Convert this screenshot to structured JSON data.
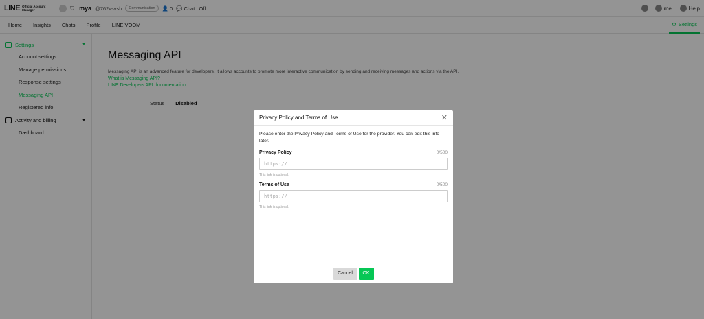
{
  "header": {
    "logo_text": "LINE",
    "logo_sub": "Official Account Manager",
    "account_name": "mya",
    "account_id": "@762vsvsb",
    "account_badge": "Communication",
    "followers": "0",
    "chat_status": "Chat : Off",
    "user_name": "mei",
    "help_label": "Help"
  },
  "nav": {
    "tabs": [
      "Home",
      "Insights",
      "Chats",
      "Profile",
      "LINE VOOM"
    ],
    "settings_label": "Settings"
  },
  "sidebar": {
    "settings_group": "Settings",
    "settings_items": [
      "Account settings",
      "Manage permissions",
      "Response settings",
      "Messaging API",
      "Registered info"
    ],
    "billing_group": "Activity and billing",
    "billing_items": [
      "Dashboard"
    ]
  },
  "main": {
    "title": "Messaging API",
    "description": "Messaging API is an advanced feature for developers. It allows accounts to promote more interactive communication by sending and receiving messages and actions via the API.",
    "link1": "What is Messaging API?",
    "link2": "LINE Developers API documentation",
    "status_label": "Status",
    "status_value": "Disabled"
  },
  "modal": {
    "title": "Privacy Policy and Terms of Use",
    "description": "Please enter the Privacy Policy and Terms of Use for the provider. You can edit this info later.",
    "privacy_label": "Privacy Policy",
    "privacy_count": "0/500",
    "privacy_placeholder": "https://",
    "privacy_hint": "This link is optional.",
    "terms_label": "Terms of Use",
    "terms_count": "0/500",
    "terms_placeholder": "https://",
    "terms_hint": "This link is optional.",
    "cancel_label": "Cancel",
    "ok_label": "OK"
  },
  "colors": {
    "accent": "#06c755",
    "overlay": "rgba(0,0,0,0.42)"
  }
}
